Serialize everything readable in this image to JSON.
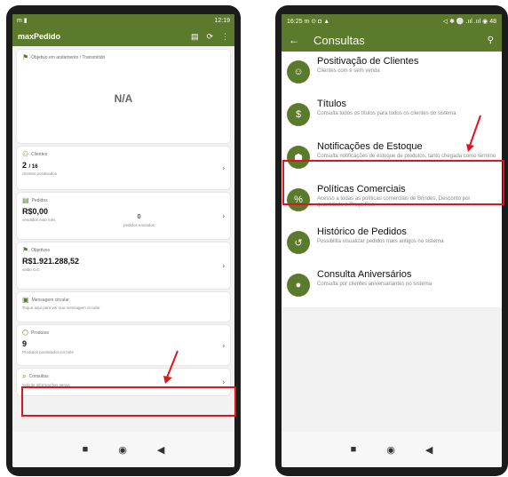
{
  "left": {
    "status": {
      "left": "m ▮",
      "right": "12:19"
    },
    "app_title": "maxPedido",
    "objective_card": {
      "label": "Objetivo em andamento / Transmitido",
      "value": "N/A"
    },
    "clients_card": {
      "label": "Clientes",
      "value": "2",
      "value_suffix": "/ 16",
      "sub": "clientes positivados"
    },
    "orders_card": {
      "label": "Pedidos",
      "value": "R$0,00",
      "sub": "vendidos este mês",
      "count": "0",
      "count_sub": "pedidos enviados"
    },
    "objectives_card": {
      "label": "Objetivos",
      "value": "R$1.921.288,52",
      "sub": "saldo C/C"
    },
    "message_card": {
      "label": "Mensagem circular",
      "sub": "Toque aqui para ver sua mensagem circular"
    },
    "products_card": {
      "label": "Produtos",
      "value": "9",
      "sub": "Produtos positivados no mês"
    },
    "consultas_card": {
      "label": "Consultas",
      "sub": "Solicite informações gerais"
    }
  },
  "right": {
    "status": {
      "time": "16:25",
      "right": "48"
    },
    "title": "Consultas",
    "items": [
      {
        "title": "Positivação de Clientes",
        "sub": "Clientes com e sem venda",
        "icon": "people-icon"
      },
      {
        "title": "Títulos",
        "sub": "Consulta todos os títulos para todos os clientes do sistema",
        "icon": "money-icon"
      },
      {
        "title": "Notificações de Estoque",
        "sub": "Consulta notificações de estoque de produtos, tanto chegada como término",
        "icon": "box-icon"
      },
      {
        "title": "Políticas Comerciais",
        "sub": "Acesso a todas as políticas comerciais de Brindes, Desconto por quantidade e Preço Fixo",
        "icon": "discount-icon"
      },
      {
        "title": "Histórico de Pedidos",
        "sub": "Possibilita visualizar pedidos mais antigos no sistema",
        "icon": "history-icon"
      },
      {
        "title": "Consulta Aniversários",
        "sub": "Consulta por clientes aniversariantes no sistema",
        "icon": "balloon-icon"
      }
    ]
  },
  "colors": {
    "brand": "#5b7a2c",
    "highlight": "#e0141e"
  }
}
